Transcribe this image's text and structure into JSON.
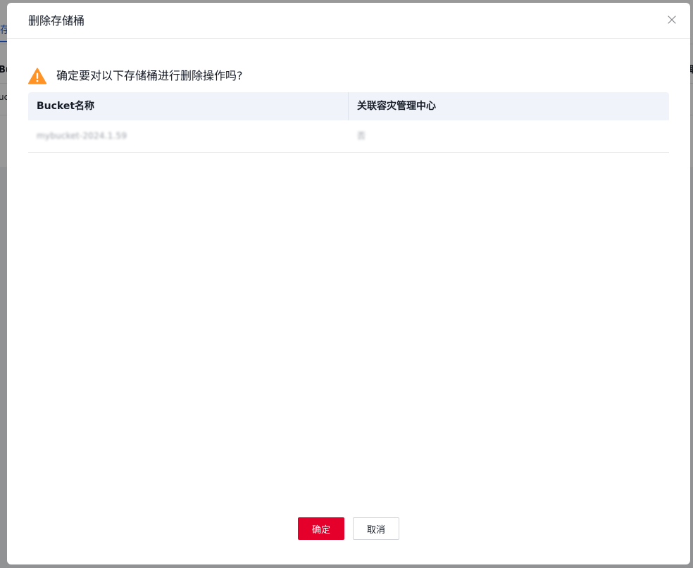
{
  "background": {
    "tab_fragment": "存",
    "head_left_fragment": "Bu",
    "cell_left_fragment": "uc",
    "head_right_fragment": "取"
  },
  "modal": {
    "title": "删除存储桶",
    "warning": "确定要对以下存储桶进行删除操作吗?",
    "table": {
      "columns": [
        "Bucket名称",
        "关联容灾管理中心"
      ],
      "rows": [
        {
          "bucket": "mybucket-2024.1.59",
          "center": "否"
        }
      ]
    },
    "buttons": {
      "confirm": "确定",
      "cancel": "取消"
    }
  },
  "colors": {
    "primary": "#e4002b",
    "warning": "#ff9326",
    "link": "#2468f2",
    "header_bg": "#f0f3fa"
  },
  "icons": {
    "close": "close-icon",
    "warning": "warning-triangle-icon"
  }
}
